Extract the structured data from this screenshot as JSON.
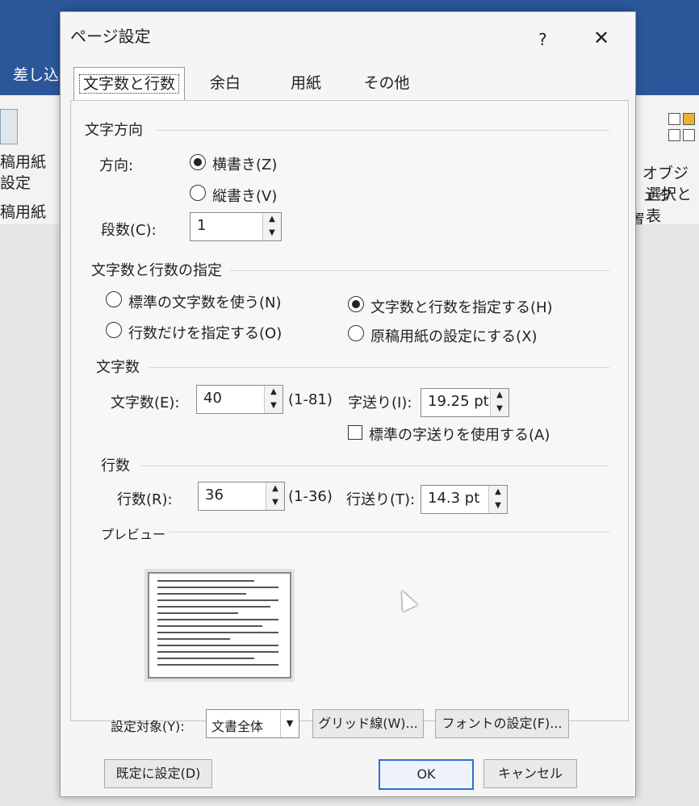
{
  "background": {
    "ribbon_tab_partial": "差し込み",
    "left_group_line1": "稿用紙",
    "left_group_line2": "設定",
    "left_group_label": "稿用紙",
    "right_label_line1": "オブジェク",
    "right_label_line2": "選択と表",
    "right_group_label": "置"
  },
  "dialog": {
    "title": "ページ設定",
    "help": "?",
    "close": "✕",
    "tabs": [
      "文字数と行数",
      "余白",
      "用紙",
      "その他"
    ],
    "direction_group": "文字方向",
    "direction_label": "方向:",
    "horizontal": "横書き(Z)",
    "vertical": "縦書き(V)",
    "columns_label": "段数(C):",
    "columns_value": "1",
    "spec_group": "文字数と行数の指定",
    "opt_standard": "標準の文字数を使う(N)",
    "opt_lines_only": "行数だけを指定する(O)",
    "opt_chars_lines": "文字数と行数を指定する(H)",
    "opt_manuscript": "原稿用紙の設定にする(X)",
    "chars_group": "文字数",
    "chars_label": "文字数(E):",
    "chars_value": "40",
    "chars_range": "(1-81)",
    "char_pitch_label": "字送り(I):",
    "char_pitch_value": "19.25 pt",
    "use_std_pitch": "標準の字送りを使用する(A)",
    "lines_group": "行数",
    "lines_label": "行数(R):",
    "lines_value": "36",
    "lines_range": "(1-36)",
    "line_pitch_label": "行送り(T):",
    "line_pitch_value": "14.3 pt",
    "preview_group": "プレビュー",
    "apply_label": "設定対象(Y):",
    "apply_value": "文書全体",
    "grid_button": "グリッド線(W)...",
    "font_button": "フォントの設定(F)...",
    "default_button": "既定に設定(D)",
    "ok_button": "OK",
    "cancel_button": "キャンセル"
  },
  "colors": {
    "title_bar": "#2b579a",
    "ok_border": "#2f6fd0"
  }
}
